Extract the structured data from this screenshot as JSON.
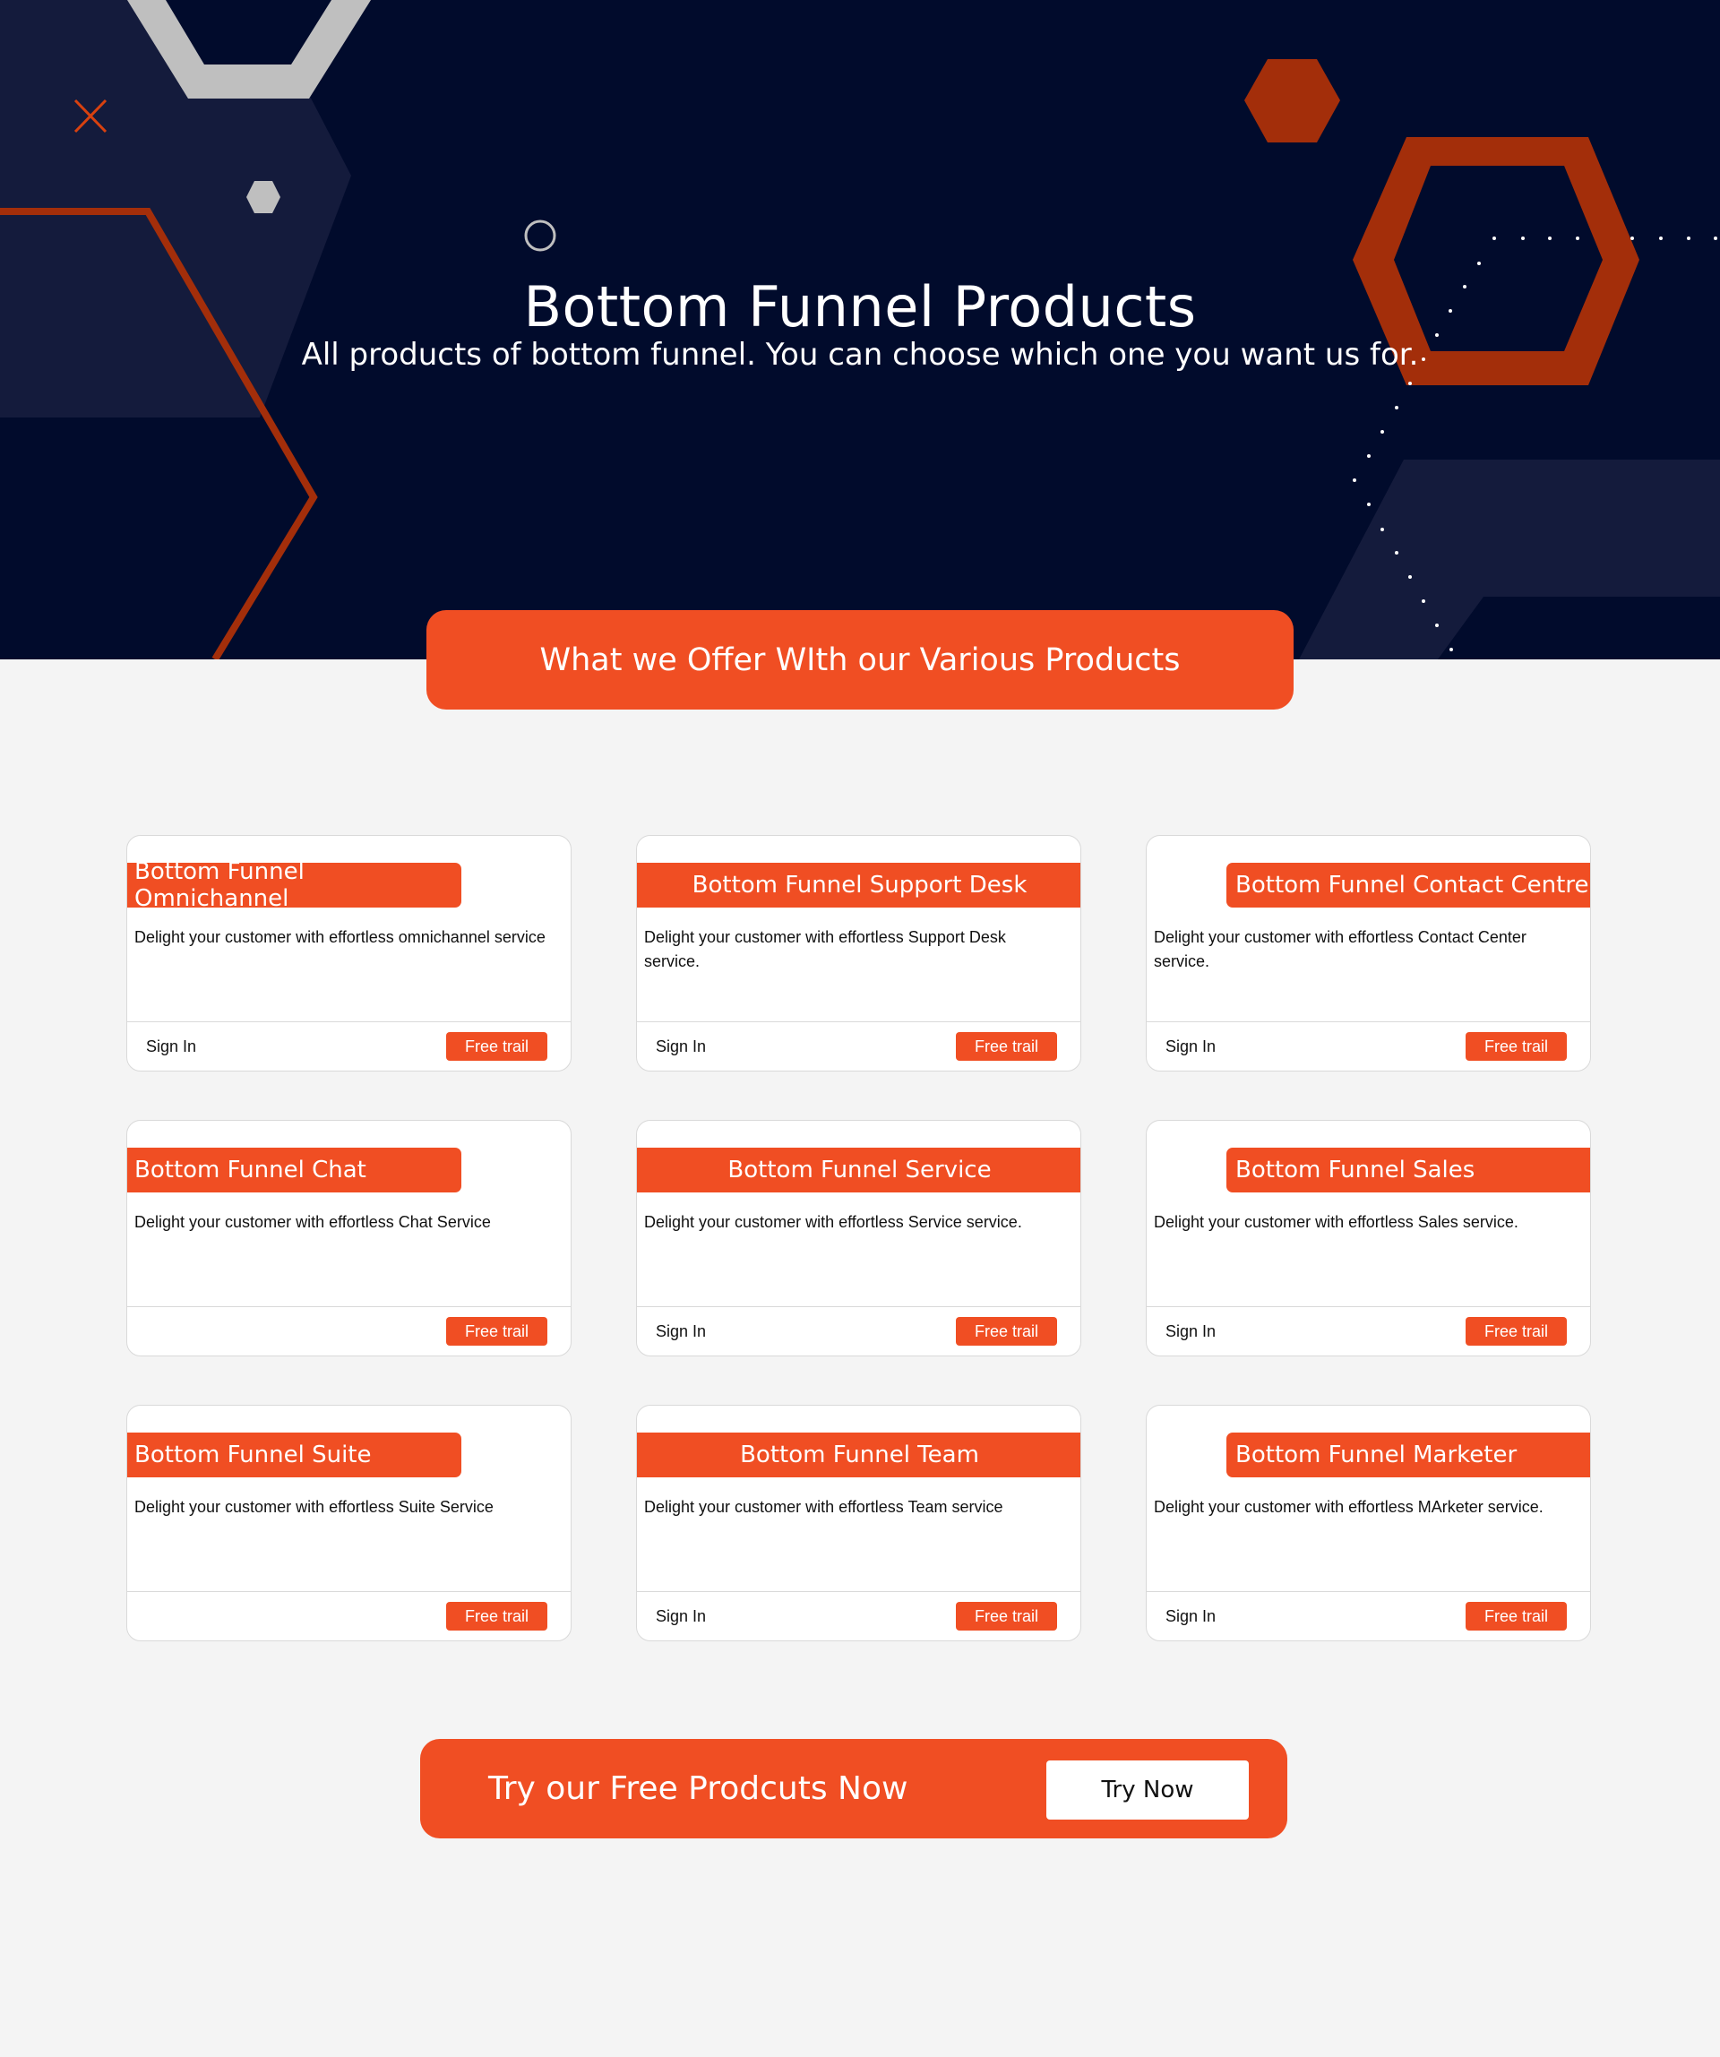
{
  "hero": {
    "title": "Bottom Funnel Products",
    "subtitle": "All products of bottom funnel. You can choose which one you want us for."
  },
  "offer_banner": "What we Offer WIth our Various Products",
  "cards": [
    {
      "title": "Bottom Funnel Omnichannel",
      "desc": "Delight your customer with effortless omnichannel service",
      "sign_in": "Sign In",
      "free_trial": "Free trail"
    },
    {
      "title": "Bottom Funnel Support Desk",
      "desc": "Delight your customer with effortless Support Desk service.",
      "sign_in": "Sign In",
      "free_trial": "Free trail"
    },
    {
      "title": "Bottom Funnel Contact Centre",
      "desc": "Delight your customer with effortless Contact Center service.",
      "sign_in": "Sign In",
      "free_trial": "Free trail"
    },
    {
      "title": "Bottom Funnel Chat",
      "desc": "Delight your customer with effortless Chat Service",
      "sign_in": "",
      "free_trial": "Free trail"
    },
    {
      "title": "Bottom Funnel Service",
      "desc": "Delight your customer with effortless Service service.",
      "sign_in": "Sign In",
      "free_trial": "Free trail"
    },
    {
      "title": "Bottom Funnel Sales",
      "desc": "Delight your customer with effortless Sales  service.",
      "sign_in": "Sign In",
      "free_trial": "Free trail"
    },
    {
      "title": "Bottom Funnel Suite",
      "desc": "Delight your customer with effortless Suite Service",
      "sign_in": "",
      "free_trial": "Free trail"
    },
    {
      "title": "Bottom Funnel Team",
      "desc": "Delight your customer with effortless Team service",
      "sign_in": "Sign In",
      "free_trial": "Free trail"
    },
    {
      "title": "Bottom Funnel Marketer",
      "desc": "Delight your customer with effortless MArketer service.",
      "sign_in": "Sign In",
      "free_trial": "Free trail"
    }
  ],
  "cta": {
    "text": "Try our Free Prodcuts Now",
    "button": "Try Now"
  },
  "colors": {
    "accent": "#f04e23",
    "hero_bg": "#010b2c",
    "deco_red": "#a32e0a",
    "deco_grey": "#bfbfbf",
    "page_bg": "#f4f4f4"
  },
  "icons": [
    "close-x-icon",
    "hexagon-icon",
    "circle-icon"
  ]
}
